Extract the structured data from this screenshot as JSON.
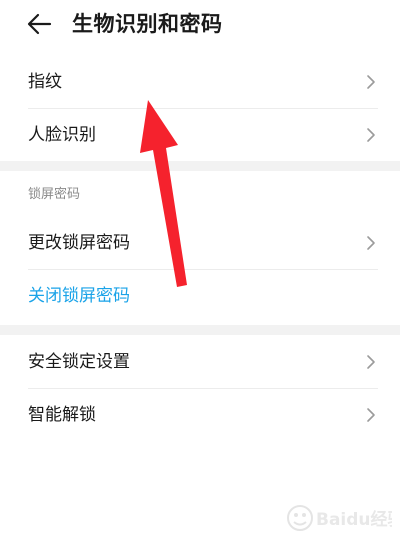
{
  "header": {
    "title": "生物识别和密码",
    "back_icon": "arrow-left-icon"
  },
  "biometrics": {
    "items": [
      {
        "label": "指纹"
      },
      {
        "label": "人脸识别"
      }
    ]
  },
  "lock_screen": {
    "section_title": "锁屏密码",
    "change_label": "更改锁屏密码",
    "disable_label": "关闭锁屏密码"
  },
  "security": {
    "items": [
      {
        "label": "安全锁定设置"
      },
      {
        "label": "智能解锁"
      }
    ]
  },
  "overlay": {
    "annotation": "red-arrow-pointing-up",
    "arrow_color": "#f5222d"
  },
  "watermark": {
    "text": "Baidu经验"
  },
  "colors": {
    "accent": "#1aa3e8",
    "text": "#1a1a1a",
    "secondary_text": "#8a8a8a",
    "separator_band": "#f2f2f2"
  }
}
